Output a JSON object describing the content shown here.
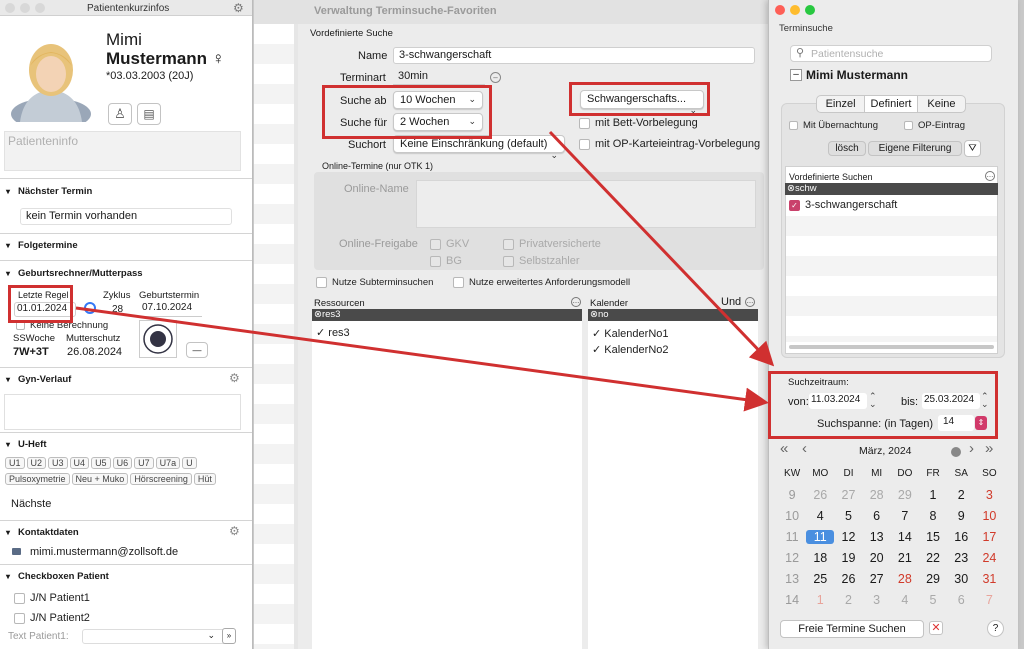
{
  "left": {
    "title": "Patientenkurzinfos",
    "first_name": "Mimi",
    "last_name": "Mustermann",
    "gender_symbol": "♀",
    "birth": "*03.03.2003 (20J)",
    "patienteninfo_placeholder": "Patienteninfo",
    "sec_next": "Nächster Termin",
    "next_value": "kein Termin vorhanden",
    "sec_follow": "Folgetermine",
    "sec_birth": "Geburtsrechner/Mutterpass",
    "letzte_regel_label": "Letzte Regel",
    "letzte_regel_value": "01.01.2024",
    "zyklus_label": "Zyklus",
    "zyklus_value": "28",
    "geburtstermin_label": "Geburtstermin",
    "geburtstermin_value": "07.10.2024",
    "keine_berechnung": "Keine Berechnung",
    "ssw_label": "SSWoche",
    "ssw_value": "7W+3T",
    "mutterschutz_label": "Mutterschutz",
    "mutterschutz_value": "26.08.2024",
    "minus_btn": "—",
    "sec_gyn": "Gyn-Verlauf",
    "sec_uheft": "U-Heft",
    "uheft_pills": [
      "U1",
      "U2",
      "U3",
      "U4",
      "U5",
      "U6",
      "U7",
      "U7a",
      "U"
    ],
    "uheft_pills2": [
      "Pulsoxymetrie",
      "Neu + Muko",
      "Hörscreening",
      "Hüt"
    ],
    "naechste": "Nächste",
    "sec_kontakt": "Kontaktdaten",
    "email": "mimi.mustermann@zollsoft.de",
    "sec_checkboxen": "Checkboxen Patient",
    "cb1": "J/N Patient1",
    "cb2": "J/N Patient2",
    "text_patient_label": "Text Patient1:"
  },
  "middle": {
    "title": "Verwaltung Terminsuche-Favoriten",
    "vordef_label": "Vordefinierte Suche",
    "name_label": "Name",
    "name_value": "3-schwangerschaft",
    "terminart_label": "Terminart",
    "terminart_value": "30min",
    "suche_ab_label": "Suche ab",
    "suche_ab_value": "10 Wochen",
    "suche_fuer_label": "Suche für",
    "suche_fuer_value": "2 Wochen",
    "suchort_label": "Suchort",
    "suchort_value": "Keine Einschränkung (default)",
    "schwanger_popup": "Schwangerschafts...",
    "bett": "mit Bett-Vorbelegung",
    "op_kartei": "mit OP-Karteieintrag-Vorbelegung",
    "online_group": "Online-Termine (nur OTK 1)",
    "online_name_label": "Online-Name",
    "online_freigabe_label": "Online-Freigabe",
    "gkv": "GKV",
    "privat": "Privatversicherte",
    "bg": "BG",
    "selbstzahler": "Selbstzahler",
    "nutze_sub": "Nutze Subterminsuchen",
    "nutze_anf": "Nutze erweitertes Anforderungsmodell",
    "ressourcen_label": "Ressourcen",
    "ressourcen_filter": "res3",
    "res_item": "res3",
    "kalender_label": "Kalender",
    "und_label": "Und",
    "kalender_filter": "no",
    "kal_items": [
      "KalenderNo1",
      "KalenderNo2"
    ]
  },
  "right": {
    "title": "Terminsuche",
    "search_placeholder": "Patientensuche",
    "patient": "Mimi Mustermann",
    "tabs": [
      "Einzel",
      "Definiert",
      "Keine"
    ],
    "mit_uebernachtung": "Mit Übernachtung",
    "op_eintrag": "OP-Eintrag",
    "loesch": "lösch",
    "eigene_filterung": "Eigene Filterung",
    "vordef_label": "Vordefinierte Suchen",
    "vordef_filter": "schw",
    "vordef_item": "3-schwangerschaft",
    "suchzeitraum": "Suchzeitraum:",
    "von_label": "von:",
    "von_value": "11.03.2024",
    "bis_label": "bis:",
    "bis_value": "25.03.2024",
    "suchspanne_label": "Suchspanne: (in Tagen)",
    "suchspanne_value": "14",
    "month": "März, 2024",
    "weekday_header": [
      "KW",
      "MO",
      "DI",
      "MI",
      "DO",
      "FR",
      "SA",
      "SO"
    ],
    "weeks": [
      [
        "9",
        "26",
        "27",
        "28",
        "29",
        "1",
        "2",
        "3"
      ],
      [
        "10",
        "4",
        "5",
        "6",
        "7",
        "8",
        "9",
        "10"
      ],
      [
        "11",
        "11",
        "12",
        "13",
        "14",
        "15",
        "16",
        "17"
      ],
      [
        "12",
        "18",
        "19",
        "20",
        "21",
        "22",
        "23",
        "24"
      ],
      [
        "13",
        "25",
        "26",
        "27",
        "28",
        "29",
        "30",
        "31"
      ],
      [
        "14",
        "1",
        "2",
        "3",
        "4",
        "5",
        "6",
        "7"
      ]
    ],
    "freie_termine": "Freie Termine Suchen",
    "help": "?"
  },
  "colors": {
    "accent": "#3478f6",
    "red_box": "#d03030",
    "holiday": "#d13a2a",
    "today_bg": "#4a8fe0"
  }
}
